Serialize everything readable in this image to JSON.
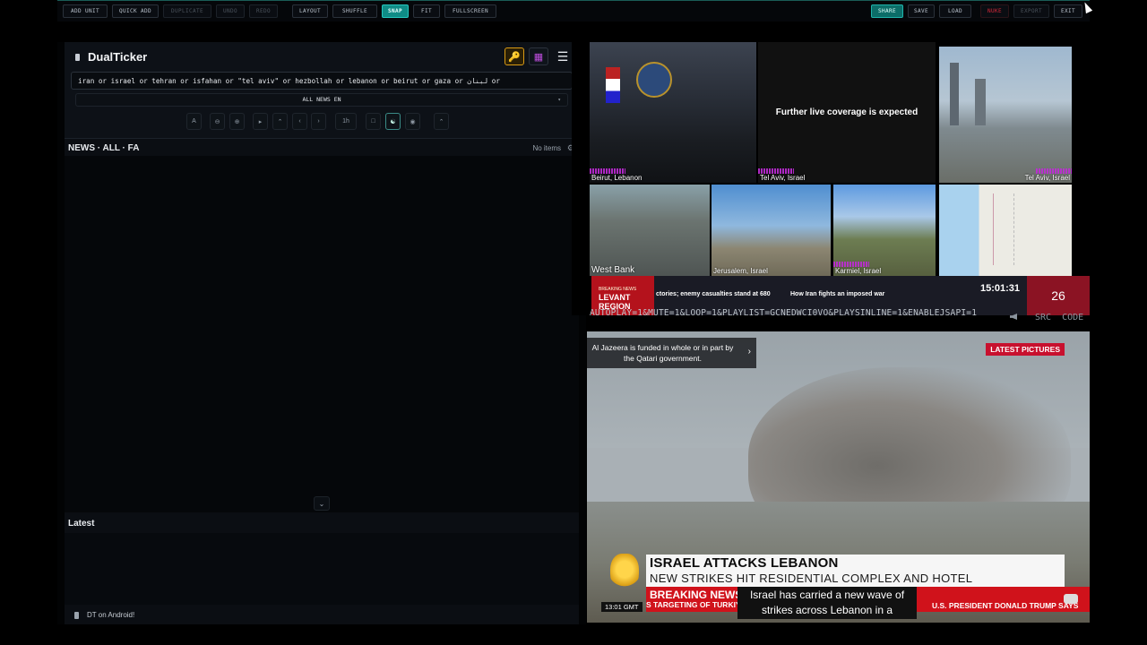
{
  "toolbar": {
    "buttons": [
      "ADD UNIT",
      "QUICK ADD",
      "DUPLICATE",
      "UNDO",
      "REDO",
      "LAYOUT",
      "SHUFFLE",
      "SNAP",
      "FIT",
      "FULLSCREEN"
    ],
    "right_buttons": [
      "SHARE",
      "SAVE",
      "LOAD",
      "NUKE",
      "EXPORT",
      "EXIT"
    ],
    "active": "SNAP"
  },
  "app": {
    "title": "DualTicker",
    "query": "iran or israel or tehran or isfahan or \"tel aviv\" or hezbollah or lebanon or beirut or gaza or لبنان or",
    "news_select": "ALL NEWS EN",
    "tools": [
      "A",
      "1h"
    ],
    "feed_label": "NEWS · ALL · FA",
    "items_count": "No items",
    "latest_label": "Latest",
    "android_promo": "DT on Android!"
  },
  "cams": {
    "labels": [
      "Beirut, Lebanon",
      "Tel Aviv, Israel",
      "Tel Aviv, Israel",
      "West Bank",
      "Jerusalem, Israel",
      "Karmiel, Israel"
    ],
    "live_message": "Further live coverage is expected",
    "ticker": {
      "breaking": "BREAKING NEWS",
      "region": "LEVANT REGION",
      "item1": "ctories; enemy casualties stand at 680",
      "item2": "How Iran fights an imposed war",
      "clock": "15:01:31",
      "date_num": "26"
    }
  },
  "stream": {
    "url": "AUTOPLAY=1&MUTE=1&LOOP=1&PLAYLIST=GCNEDWCI0VO&PLAYSINLINE=1&ENABLEJSAPI=1",
    "src_label": "SRC",
    "code_label": "CODE"
  },
  "video": {
    "info_card": "Al Jazeera is funded in whole or in part by the Qatari government.",
    "badge": "LATEST PICTURES",
    "headline": "ISRAEL ATTACKS LEBANON",
    "subhead": "NEW STRIKES HIT RESIDENTIAL COMPLEX AND HOTEL",
    "breaking": "BREAKING NEWS",
    "caption": "Israel has carried a new wave of strikes across Lebanon in a",
    "ticker_left": "S TARGETING OF TURKIYE",
    "ticker_right": "U.S. PRESIDENT DONALD TRUMP SAYS",
    "time": "13:01 GMT"
  },
  "colors": {
    "accent": "#0f8c86",
    "danger": "#d8283a",
    "key_icon": "#f3b322",
    "aj_red": "#d0121b"
  }
}
